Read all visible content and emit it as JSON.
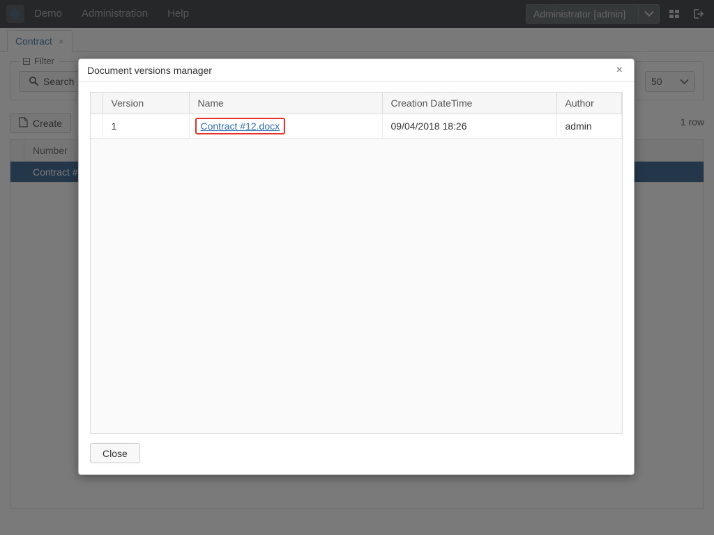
{
  "topbar": {
    "logo_icon": "app-logo-icon",
    "nav": [
      {
        "label": "Demo"
      },
      {
        "label": "Administration"
      },
      {
        "label": "Help"
      }
    ],
    "user_select": {
      "value": "Administrator [admin]",
      "arrow_icon": "chevron-down-icon"
    },
    "grid_icon": "apps-grid-icon",
    "logout_icon": "logout-icon"
  },
  "tabs": [
    {
      "label": "Contract",
      "close": "×"
    }
  ],
  "filter": {
    "legend": "Filter",
    "collapse_icon": "collapse-minus-icon",
    "search_label": "Search",
    "search_icon": "search-icon",
    "pagesize_value": "50",
    "pagesize_arrow_icon": "chevron-down-icon"
  },
  "toolbar": {
    "create_label": "Create",
    "create_icon": "new-document-icon",
    "row_count": "1 row"
  },
  "background_grid": {
    "columns": [
      "Number"
    ],
    "rows": [
      {
        "number": "Contract #12"
      }
    ]
  },
  "modal": {
    "title": "Document versions manager",
    "close_icon": "×",
    "table": {
      "columns": [
        "Version",
        "Name",
        "Creation DateTime",
        "Author"
      ],
      "rows": [
        {
          "version": "1",
          "name": "Contract #12.docx",
          "creation_datetime": "09/04/2018 18:26",
          "author": "admin"
        }
      ]
    },
    "close_button_label": "Close"
  },
  "colors": {
    "topbar_bg": "#22262a",
    "accent_link": "#2f6fb5",
    "highlight_border": "#e8302a",
    "selected_row": "#1e5080",
    "tab_label": "#2b6ca3"
  }
}
